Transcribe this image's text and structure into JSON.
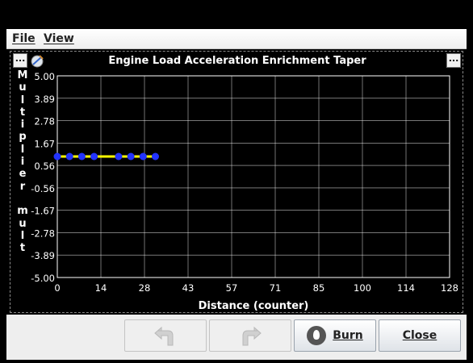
{
  "menu": {
    "file": "File",
    "view": "View"
  },
  "chart_data": {
    "type": "line",
    "title": "Engine Load Acceleration Enrichment Taper",
    "ylabel": "Multiplier mult",
    "ylabel_chars": [
      "M",
      "u",
      "l",
      "t",
      "i",
      "p",
      "l",
      "i",
      "e",
      "r",
      "",
      "m",
      "u",
      "l",
      "t"
    ],
    "xlabel": "Distance (counter)",
    "xlim": [
      0,
      128
    ],
    "ylim": [
      -5.0,
      5.0
    ],
    "x_ticks": [
      "0",
      "14",
      "28",
      "43",
      "57",
      "71",
      "85",
      "100",
      "114",
      "128"
    ],
    "y_ticks": [
      "5.00",
      "3.89",
      "2.78",
      "1.67",
      "0.56",
      "-0.56",
      "-1.67",
      "-2.78",
      "-3.89",
      "-5.00"
    ],
    "grid": true,
    "line_color": "#ffff00",
    "point_color": "#2233ff",
    "series": [
      {
        "x": [
          0,
          4,
          8,
          12,
          20,
          24,
          28,
          32
        ],
        "y": [
          1.0,
          1.0,
          1.0,
          1.0,
          1.0,
          1.0,
          1.0,
          1.0
        ]
      }
    ]
  },
  "buttons": {
    "undo_label": "",
    "redo_label": "",
    "burn_label": "Burn",
    "close_label": "Close"
  },
  "icons": {
    "corner_left": "more-options-icon",
    "chart_tool": "chart-tool-icon",
    "corner_right": "more-options-icon",
    "burn": "burn-icon",
    "undo": "undo-icon",
    "redo": "redo-icon"
  }
}
